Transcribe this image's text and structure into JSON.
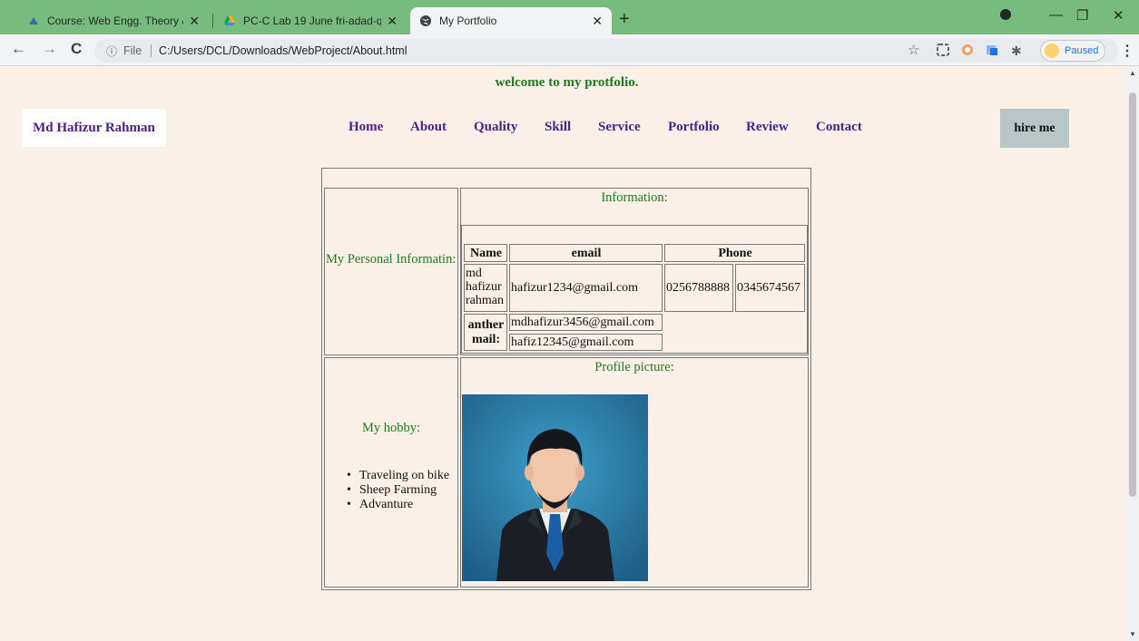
{
  "browser": {
    "tabs": [
      {
        "title": "Course: Web Engg. Theory & Lab",
        "active": false
      },
      {
        "title": "PC-C Lab 19 June fri-adad-qmw",
        "active": false
      },
      {
        "title": "My Portfolio",
        "active": true
      }
    ],
    "new_tab_icon": "plus-icon",
    "url_scheme_label": "File",
    "url": "C:/Users/DCL/Downloads/WebProject/About.html",
    "profile_status": "Paused",
    "accent_color": "#77bc7e"
  },
  "page": {
    "welcome": "welcome to my protfolio.",
    "brand": "Md Hafizur Rahman",
    "nav": [
      "Home",
      "About",
      "Quality",
      "Skill",
      "Service",
      "Portfolio",
      "Review",
      "Contact"
    ],
    "hire_button": "hire me",
    "personal_label": "My Personal Informatin:",
    "information_label": "Information:",
    "table": {
      "headers": {
        "name": "Name",
        "email": "email",
        "phone": "Phone"
      },
      "name_lines": [
        "md",
        "hafizur",
        "rahman"
      ],
      "email": "hafizur1234@gmail.com",
      "phones": [
        "0256788888",
        "0345674567"
      ],
      "other_mail_label_lines": [
        "anther",
        "mail:"
      ],
      "other_emails": [
        "mdhafizur3456@gmail.com",
        "hafiz12345@gmail.com"
      ]
    },
    "hobby_label": "My hobby:",
    "hobbies": [
      "Traveling on bike",
      "Sheep Farming",
      "Advanture"
    ],
    "profile_picture_label": "Profile picture:"
  }
}
